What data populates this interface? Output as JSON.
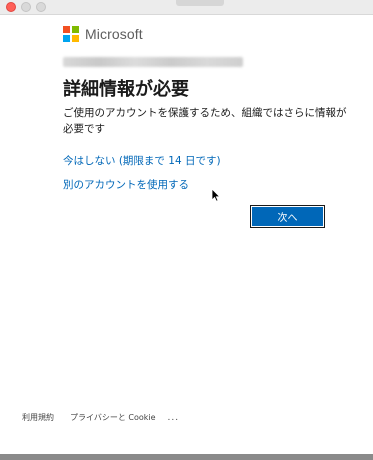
{
  "brand": {
    "name": "Microsoft",
    "colors": [
      "#f25022",
      "#7fba00",
      "#00a4ef",
      "#ffb900"
    ]
  },
  "main": {
    "heading": "詳細情報が必要",
    "description": "ご使用のアカウントを保護するため、組織ではさらに情報が必要です",
    "skip_link": "今はしない (期限まで 14 日です)",
    "other_account_link": "別のアカウントを使用する",
    "next_button": "次へ"
  },
  "footer": {
    "terms": "利用規約",
    "privacy": "プライバシーと Cookie",
    "more": "..."
  },
  "colors": {
    "accent": "#0067b8",
    "heading_text": "#1b1b1b"
  }
}
